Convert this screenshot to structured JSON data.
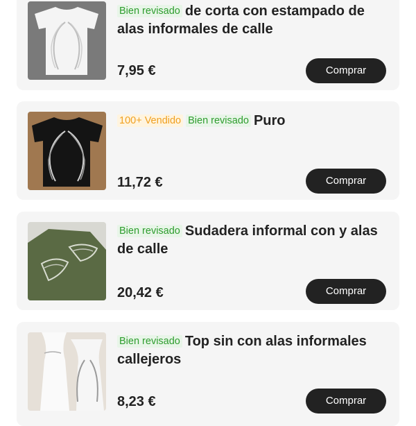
{
  "products": [
    {
      "badges": [
        {
          "text": "Bien revisado",
          "kind": "green"
        }
      ],
      "title": "de corta con estampado de alas informales de calle",
      "price": "7,95 €",
      "buy_label": "Comprar",
      "image_icon": "white-tshirt-wings-image"
    },
    {
      "badges": [
        {
          "text": "100+ Vendido",
          "kind": "orange"
        },
        {
          "text": "Bien revisado",
          "kind": "green"
        }
      ],
      "title": "Puro",
      "price": "11,72 €",
      "buy_label": "Comprar",
      "image_icon": "black-tshirt-wings-image"
    },
    {
      "badges": [
        {
          "text": "Bien revisado",
          "kind": "green"
        }
      ],
      "title": "Sudadera informal con y alas de calle",
      "price": "20,42 €",
      "buy_label": "Comprar",
      "image_icon": "green-sweatshirt-wings-image"
    },
    {
      "badges": [
        {
          "text": "Bien revisado",
          "kind": "green"
        }
      ],
      "title": "Top sin con alas informales callejeros",
      "price": "8,23 €",
      "buy_label": "Comprar",
      "image_icon": "white-tank-top-wings-image"
    }
  ],
  "colors": {
    "badge_green": "#2e9d2e",
    "badge_orange": "#f0a020",
    "button_bg": "#222222",
    "card_bg": "#f5f5f5"
  }
}
